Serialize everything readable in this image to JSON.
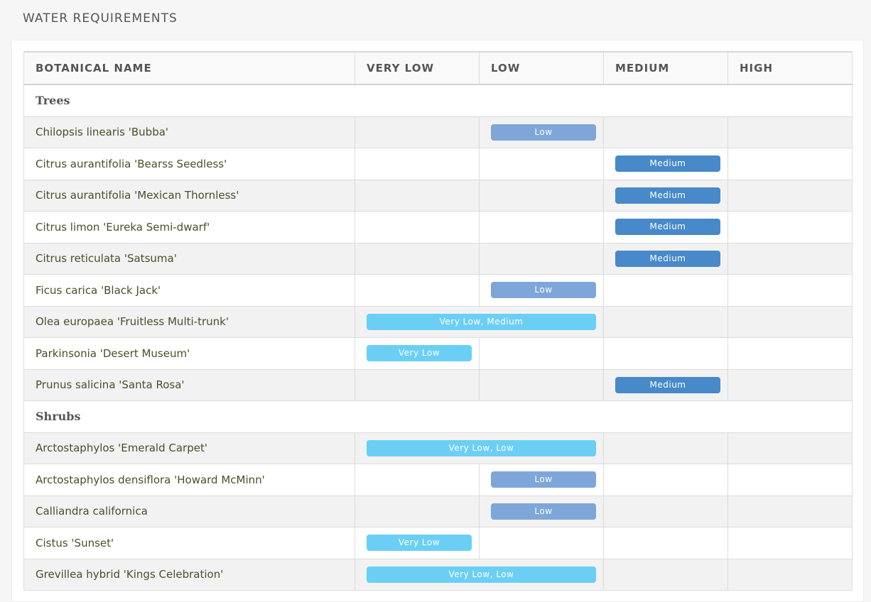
{
  "page": {
    "title": "WATER REQUIREMENTS"
  },
  "table": {
    "headers": [
      "BOTANICAL NAME",
      "VERY LOW",
      "LOW",
      "MEDIUM",
      "HIGH"
    ],
    "badge_colors": {
      "very_low": "#6bcff5",
      "low": "#7fa6d9",
      "medium": "#4789c9"
    },
    "groups": [
      {
        "name": "Trees",
        "rows": [
          {
            "name": "Chilopsis linearis 'Bubba'",
            "badge": {
              "label": "Low",
              "start": 2,
              "span": 1,
              "type": "low"
            }
          },
          {
            "name": "Citrus aurantifolia 'Bearss Seedless'",
            "badge": {
              "label": "Medium",
              "start": 3,
              "span": 1,
              "type": "medium"
            }
          },
          {
            "name": "Citrus aurantifolia 'Mexican Thornless'",
            "badge": {
              "label": "Medium",
              "start": 3,
              "span": 1,
              "type": "medium"
            }
          },
          {
            "name": "Citrus limon 'Eureka Semi-dwarf'",
            "badge": {
              "label": "Medium",
              "start": 3,
              "span": 1,
              "type": "medium"
            }
          },
          {
            "name": "Citrus reticulata 'Satsuma'",
            "badge": {
              "label": "Medium",
              "start": 3,
              "span": 1,
              "type": "medium"
            }
          },
          {
            "name": "Ficus carica 'Black Jack'",
            "badge": {
              "label": "Low",
              "start": 2,
              "span": 1,
              "type": "low"
            }
          },
          {
            "name": "Olea europaea 'Fruitless Multi-trunk'",
            "badge": {
              "label": "Very Low, Medium",
              "start": 1,
              "span": 2,
              "type": "very_low"
            }
          },
          {
            "name": "Parkinsonia 'Desert Museum'",
            "badge": {
              "label": "Very Low",
              "start": 1,
              "span": 1,
              "type": "very_low"
            }
          },
          {
            "name": "Prunus salicina 'Santa Rosa'",
            "badge": {
              "label": "Medium",
              "start": 3,
              "span": 1,
              "type": "medium"
            }
          }
        ]
      },
      {
        "name": "Shrubs",
        "rows": [
          {
            "name": "Arctostaphylos 'Emerald Carpet'",
            "badge": {
              "label": "Very Low, Low",
              "start": 1,
              "span": 2,
              "type": "very_low"
            }
          },
          {
            "name": "Arctostaphylos densiflora 'Howard McMinn'",
            "badge": {
              "label": "Low",
              "start": 2,
              "span": 1,
              "type": "low"
            }
          },
          {
            "name": "Calliandra californica",
            "badge": {
              "label": "Low",
              "start": 2,
              "span": 1,
              "type": "low"
            }
          },
          {
            "name": "Cistus 'Sunset'",
            "badge": {
              "label": "Very Low",
              "start": 1,
              "span": 1,
              "type": "very_low"
            }
          },
          {
            "name": "Grevillea hybrid 'Kings Celebration'",
            "badge": {
              "label": "Very Low, Low",
              "start": 1,
              "span": 2,
              "type": "very_low"
            }
          }
        ]
      }
    ]
  }
}
